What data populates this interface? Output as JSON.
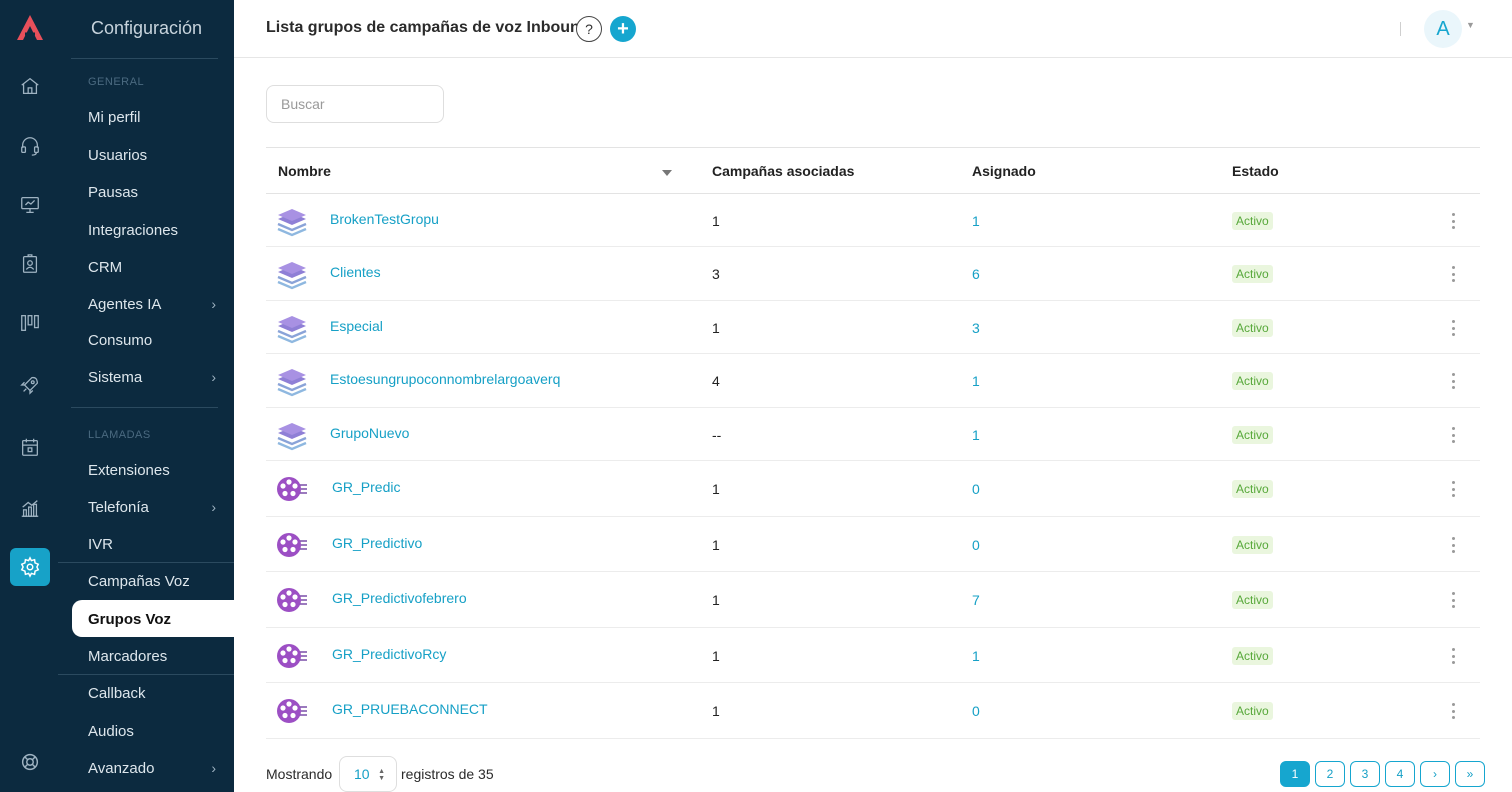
{
  "colors": {
    "sidebar_bg": "#0c2a3f",
    "accent": "#16a6cf",
    "link": "#16a0c6",
    "status_bg": "#eaf6de",
    "status_text": "#57a83a"
  },
  "rail": {
    "icons": [
      "home-icon",
      "headset-icon",
      "monitor-icon",
      "badge-icon",
      "kanban-icon",
      "rocket-icon",
      "calendar-icon",
      "chart-icon",
      "settings-icon",
      "help-buoy-icon"
    ],
    "active": "settings-icon"
  },
  "menu": {
    "title": "Configuración",
    "section_general": "GENERAL",
    "general_items": [
      {
        "label": "Mi perfil",
        "has_children": false
      },
      {
        "label": "Usuarios",
        "has_children": false
      },
      {
        "label": "Pausas",
        "has_children": false
      },
      {
        "label": "Integraciones",
        "has_children": false
      },
      {
        "label": "CRM",
        "has_children": false
      },
      {
        "label": "Agentes IA",
        "has_children": true
      },
      {
        "label": "Consumo",
        "has_children": false
      },
      {
        "label": "Sistema",
        "has_children": true
      }
    ],
    "section_calls": "LLAMADAS",
    "call_items": [
      {
        "label": "Extensiones",
        "has_children": false
      },
      {
        "label": "Telefonía",
        "has_children": true
      },
      {
        "label": "IVR",
        "has_children": false
      },
      {
        "label": "Campañas Voz",
        "has_children": false
      },
      {
        "label": "Grupos Voz",
        "has_children": false,
        "active": true
      },
      {
        "label": "Marcadores",
        "has_children": false
      },
      {
        "label": "Callback",
        "has_children": false
      },
      {
        "label": "Audios",
        "has_children": false
      },
      {
        "label": "Avanzado",
        "has_children": true
      }
    ]
  },
  "header": {
    "title": "Lista grupos de campañas de voz Inbound",
    "help_label": "?",
    "add_label": "+",
    "avatar_initial": "A"
  },
  "search": {
    "placeholder": "Buscar",
    "value": ""
  },
  "table": {
    "columns": [
      "Nombre",
      "Campañas asociadas",
      "Asignado",
      "Estado"
    ],
    "rows": [
      {
        "icon": "layers-icon",
        "name": "BrokenTestGropu",
        "campaigns": "1",
        "assigned": "1",
        "status": "Activo"
      },
      {
        "icon": "layers-icon",
        "name": "Clientes",
        "campaigns": "3",
        "assigned": "6",
        "status": "Activo"
      },
      {
        "icon": "layers-icon",
        "name": "Especial",
        "campaigns": "1",
        "assigned": "3",
        "status": "Activo"
      },
      {
        "icon": "layers-icon",
        "name": "Estoesungrupoconnombrelargoaverq",
        "campaigns": "4",
        "assigned": "1",
        "status": "Activo"
      },
      {
        "icon": "layers-icon",
        "name": "GrupoNuevo",
        "campaigns": "--",
        "assigned": "1",
        "status": "Activo"
      },
      {
        "icon": "predictive-icon",
        "name": "GR_Predic",
        "campaigns": "1",
        "assigned": "0",
        "status": "Activo"
      },
      {
        "icon": "predictive-icon",
        "name": "GR_Predictivo",
        "campaigns": "1",
        "assigned": "0",
        "status": "Activo"
      },
      {
        "icon": "predictive-icon",
        "name": "GR_Predictivofebrero",
        "campaigns": "1",
        "assigned": "7",
        "status": "Activo"
      },
      {
        "icon": "predictive-icon",
        "name": "GR_PredictivoRcy",
        "campaigns": "1",
        "assigned": "1",
        "status": "Activo"
      },
      {
        "icon": "predictive-icon",
        "name": "GR_PRUEBACONNECT",
        "campaigns": "1",
        "assigned": "0",
        "status": "Activo"
      }
    ]
  },
  "footer": {
    "showing_label": "Mostrando",
    "page_size": "10",
    "records_label": "registros de 35",
    "pages": [
      "1",
      "2",
      "3",
      "4"
    ],
    "current_page": "1",
    "next_label": "›",
    "last_label": "»"
  }
}
